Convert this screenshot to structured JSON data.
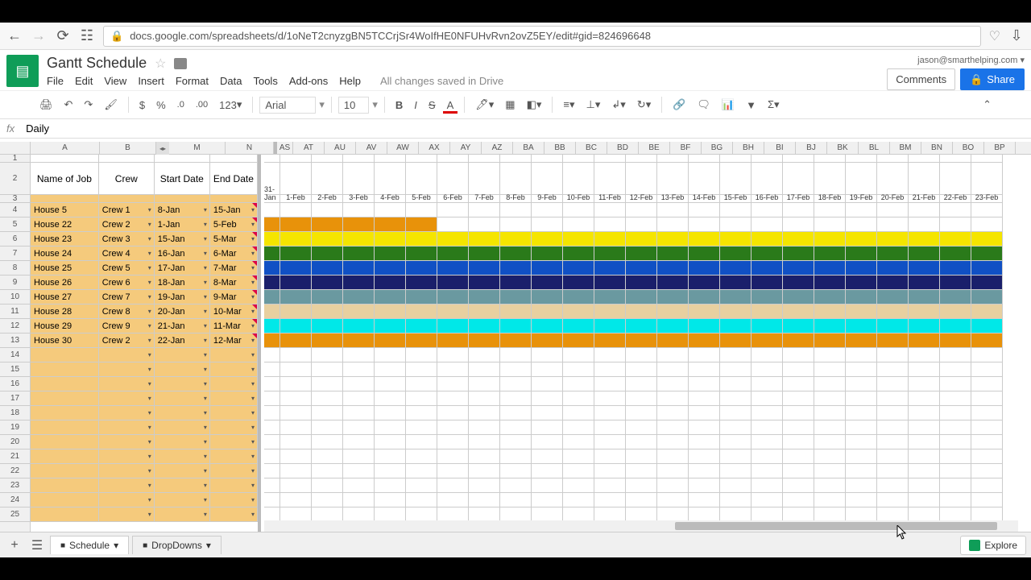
{
  "browser": {
    "url": "docs.google.com/spreadsheets/d/1oNeT2cnyzgBN5TCCrjSr4WoIfHE0NFUHvRvn2ovZ5EY/edit#gid=824696648"
  },
  "header": {
    "title": "Gantt Schedule",
    "menus": [
      "File",
      "Edit",
      "View",
      "Insert",
      "Format",
      "Data",
      "Tools",
      "Add-ons",
      "Help"
    ],
    "save_msg": "All changes saved in Drive",
    "user": "jason@smarthelping.com",
    "comments": "Comments",
    "share": "Share"
  },
  "toolbar": {
    "currency": "$",
    "percent": "%",
    "dec_dec": ".0",
    "dec_inc": ".00",
    "fmt": "123",
    "font": "Arial",
    "size": "10"
  },
  "formula": {
    "fx": "fx",
    "value": "Daily"
  },
  "columns_left": [
    "A",
    "B",
    "M",
    "N"
  ],
  "columns_right": [
    "AS",
    "AT",
    "AU",
    "AV",
    "AW",
    "AX",
    "AY",
    "AZ",
    "BA",
    "BB",
    "BC",
    "BD",
    "BE",
    "BF",
    "BG",
    "BH",
    "BI",
    "BJ",
    "BK",
    "BL",
    "BM",
    "BN",
    "BO",
    "BP"
  ],
  "header_row": {
    "a": "Name of Job",
    "b": "Crew",
    "m": "Start Date",
    "n": "End Date"
  },
  "dates": [
    "31-Jan",
    "1-Feb",
    "2-Feb",
    "3-Feb",
    "4-Feb",
    "5-Feb",
    "6-Feb",
    "7-Feb",
    "8-Feb",
    "9-Feb",
    "10-Feb",
    "11-Feb",
    "12-Feb",
    "13-Feb",
    "14-Feb",
    "15-Feb",
    "16-Feb",
    "17-Feb",
    "18-Feb",
    "19-Feb",
    "20-Feb",
    "21-Feb",
    "22-Feb",
    "23-Feb"
  ],
  "rows": [
    {
      "n": 4,
      "job": "House 5",
      "crew": "Crew 1",
      "start": "8-Jan",
      "end": "15-Jan",
      "color": "",
      "span": 0
    },
    {
      "n": 5,
      "job": "House 22",
      "crew": "Crew 2",
      "start": "1-Jan",
      "end": "5-Feb",
      "color": "c-orange",
      "span": 6
    },
    {
      "n": 6,
      "job": "House 23",
      "crew": "Crew 3",
      "start": "15-Jan",
      "end": "5-Mar",
      "color": "c-yellow",
      "span": 24
    },
    {
      "n": 7,
      "job": "House 24",
      "crew": "Crew 4",
      "start": "16-Jan",
      "end": "6-Mar",
      "color": "c-green",
      "span": 24
    },
    {
      "n": 8,
      "job": "House 25",
      "crew": "Crew 5",
      "start": "17-Jan",
      "end": "7-Mar",
      "color": "c-blue",
      "span": 24
    },
    {
      "n": 9,
      "job": "House 26",
      "crew": "Crew 6",
      "start": "18-Jan",
      "end": "8-Mar",
      "color": "c-navy",
      "span": 24
    },
    {
      "n": 10,
      "job": "House 27",
      "crew": "Crew 7",
      "start": "19-Jan",
      "end": "9-Mar",
      "color": "c-teal",
      "span": 24
    },
    {
      "n": 11,
      "job": "House 28",
      "crew": "Crew 8",
      "start": "20-Jan",
      "end": "10-Mar",
      "color": "c-tan",
      "span": 24
    },
    {
      "n": 12,
      "job": "House 29",
      "crew": "Crew 9",
      "start": "21-Jan",
      "end": "11-Mar",
      "color": "c-cyan",
      "span": 24
    },
    {
      "n": 13,
      "job": "House 30",
      "crew": "Crew 2",
      "start": "22-Jan",
      "end": "12-Mar",
      "color": "c-orange",
      "span": 24
    }
  ],
  "empty_rows": [
    14,
    15,
    16,
    17,
    18,
    19,
    20,
    21,
    22,
    23,
    24,
    25
  ],
  "tabs": {
    "t1": "Schedule",
    "t2": "DropDowns"
  },
  "explore": "Explore"
}
